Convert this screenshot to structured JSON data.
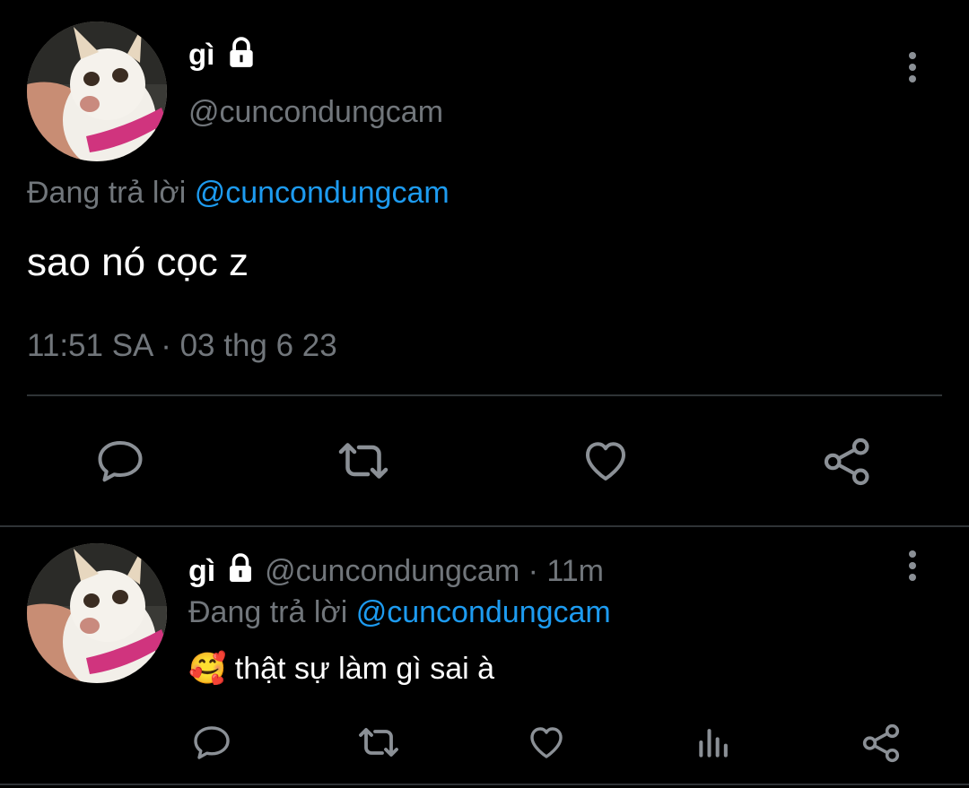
{
  "main_tweet": {
    "display_name": "gì",
    "handle": "@cuncondungcam",
    "replying_prefix": "Đang trả lời",
    "replying_to": "@cuncondungcam",
    "text": "sao nó cọc z",
    "timestamp": "11:51 SA · 03 thg 6 23",
    "actions": [
      "reply-icon",
      "retweet-icon",
      "like-icon",
      "share-icon"
    ]
  },
  "reply_tweet": {
    "display_name": "gì",
    "handle": "@cuncondungcam",
    "separator": "·",
    "age": "11m",
    "replying_prefix": "Đang trả lời",
    "replying_to": "@cuncondungcam",
    "emoji": "🥰",
    "text": "thật sự làm gì sai à",
    "actions": [
      "reply-icon",
      "retweet-icon",
      "like-icon",
      "analytics-icon",
      "share-icon"
    ]
  },
  "colors": {
    "background": "#000000",
    "text": "#e7e9ea",
    "muted": "#71767b",
    "link": "#1d9bf0",
    "divider": "#2f3336"
  }
}
